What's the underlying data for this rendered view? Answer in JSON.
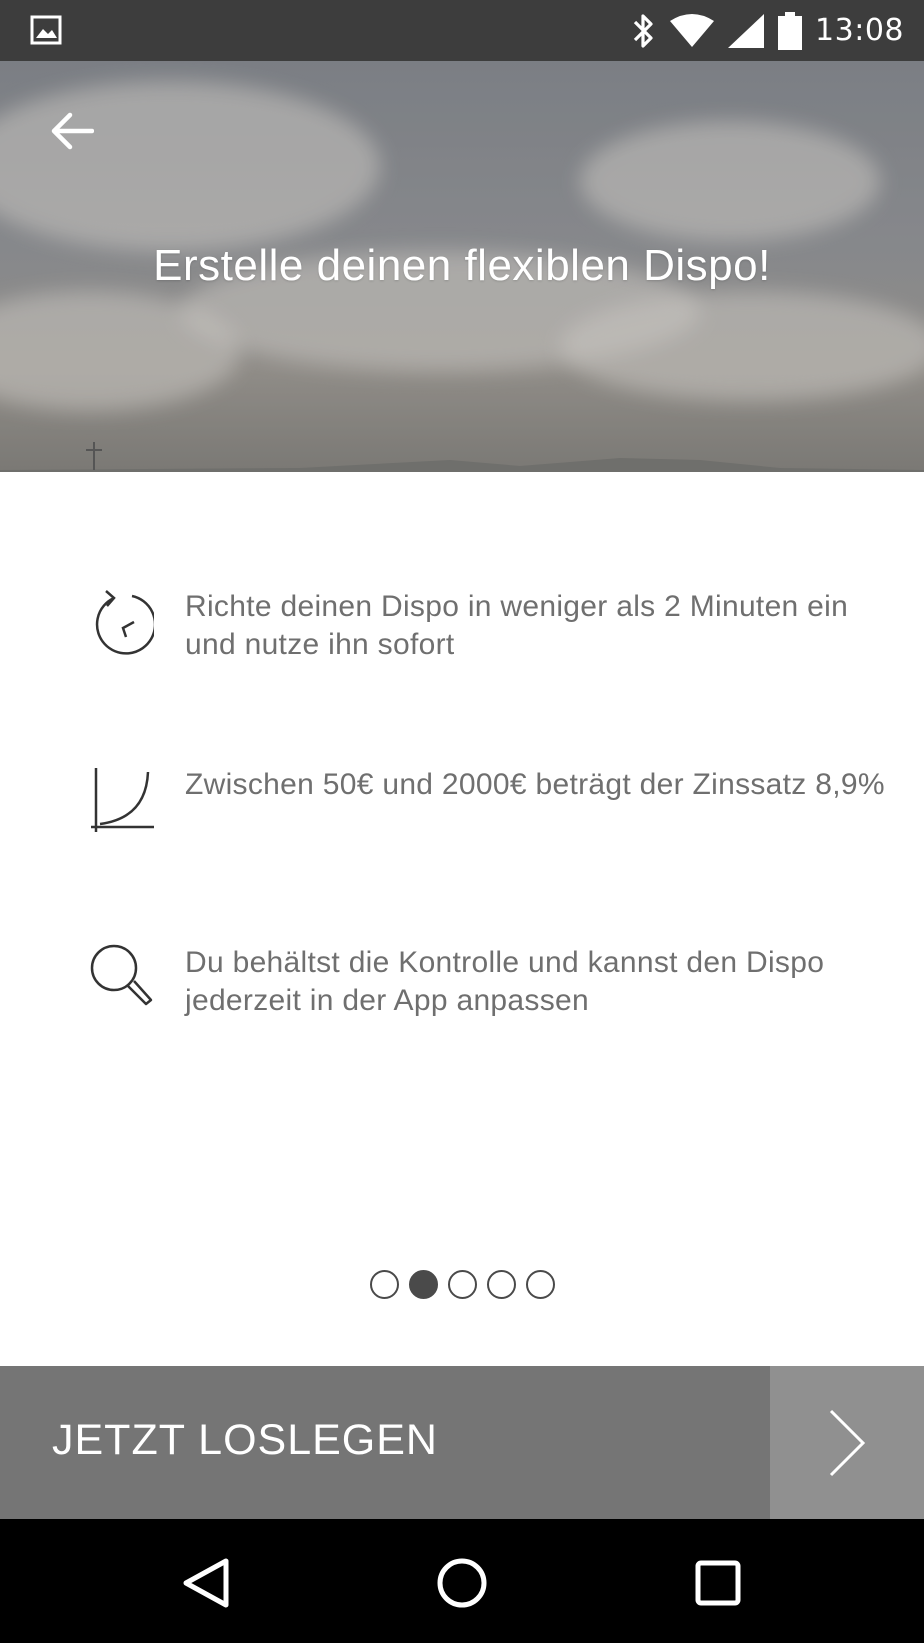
{
  "status_bar": {
    "time": "13:08",
    "icons": [
      "gallery-notification-icon",
      "bluetooth-icon",
      "wifi-icon",
      "cell-signal-icon",
      "battery-icon"
    ]
  },
  "hero": {
    "title": "Erstelle deinen flexiblen Dispo!",
    "back_icon": "arrow-left-icon"
  },
  "features": [
    {
      "icon": "clock-refresh-icon",
      "text": "Richte deinen Dispo in weniger als 2 Minuten ein und nutze ihn sofort"
    },
    {
      "icon": "growth-curve-icon",
      "text": "Zwischen 50€ und 2000€ beträgt der Zinssatz 8,9%"
    },
    {
      "icon": "magnifier-icon",
      "text": "Du behältst die Kontrolle und kannst den Dispo jederzeit in der App anpassen"
    }
  ],
  "pager": {
    "total": 5,
    "active_index": 1
  },
  "cta": {
    "label": "JETZT LOSLEGEN",
    "next_icon": "chevron-right-icon"
  },
  "nav_bar": {
    "buttons": [
      "back-triangle-icon",
      "home-circle-icon",
      "recents-square-icon"
    ]
  },
  "colors": {
    "cta_bg": "#757575",
    "cta_next_bg": "#909090",
    "text_gray": "#6f6f6f",
    "status_bar_bg": "#3d3d3d"
  }
}
